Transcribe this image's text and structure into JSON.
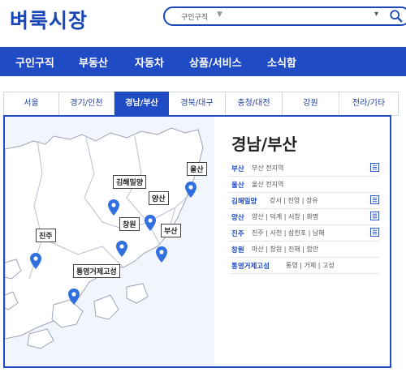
{
  "header": {
    "logo_text": "벼룩시장",
    "search_category": "구인구직",
    "search_category_chevron": "▼",
    "search_right_chevron": "▾"
  },
  "nav": {
    "items": [
      "구인구직",
      "부동산",
      "자동차",
      "상품/서비스",
      "소식함"
    ]
  },
  "tabs": [
    {
      "label": "서울",
      "active": false
    },
    {
      "label": "경기/인천",
      "active": false
    },
    {
      "label": "경남/부산",
      "active": true
    },
    {
      "label": "경북/대구",
      "active": false
    },
    {
      "label": "충청/대전",
      "active": false
    },
    {
      "label": "강원",
      "active": false
    },
    {
      "label": "전라/기타",
      "active": false
    }
  ],
  "panel": {
    "title": "경남/부산",
    "rows": [
      {
        "name": "부산",
        "subs": "부산 전지역",
        "bookmark": true
      },
      {
        "name": "울산",
        "subs": "울산 전지역",
        "bookmark": false
      },
      {
        "name": "김해밀양",
        "subs": "강서 | 진영 | 장유",
        "bookmark": true
      },
      {
        "name": "양산",
        "subs": "양산 | 덕계 | 서창 | 화명",
        "bookmark": true
      },
      {
        "name": "진주",
        "subs": "진주 | 사천 | 삼천포 | 남해",
        "bookmark": true
      },
      {
        "name": "창원",
        "subs": "마산 | 창원 | 진해 | 함안",
        "bookmark": false
      },
      {
        "name": "통영거제고성",
        "subs": "통영 | 거제 | 고성",
        "bookmark": false
      }
    ]
  },
  "map": {
    "pins": [
      "울산",
      "김해밀양",
      "양산",
      "창원",
      "부산",
      "진주",
      "통영거제고성"
    ]
  },
  "colors": {
    "brand": "#1a46b8",
    "nav_bg": "#1f4bc4",
    "pin": "#2f6fe0"
  },
  "icons": {
    "search": "search-icon",
    "pin": "map-pin-icon",
    "bookmark": "list-icon"
  }
}
